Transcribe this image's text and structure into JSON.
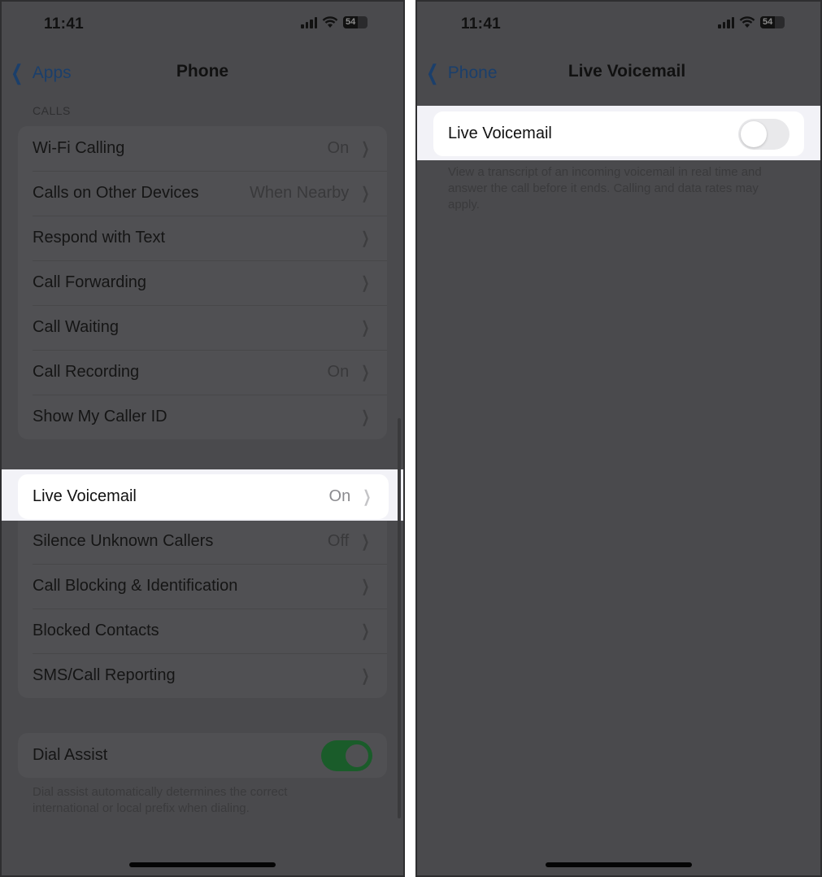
{
  "left": {
    "status": {
      "time": "11:41",
      "battery": "54"
    },
    "nav": {
      "back_label": "Apps",
      "title": "Phone"
    },
    "calls_section": {
      "header": "CALLS",
      "rows": [
        {
          "label": "Wi-Fi Calling",
          "value": "On"
        },
        {
          "label": "Calls on Other Devices",
          "value": "When Nearby"
        },
        {
          "label": "Respond with Text",
          "value": ""
        },
        {
          "label": "Call Forwarding",
          "value": ""
        },
        {
          "label": "Call Waiting",
          "value": ""
        },
        {
          "label": "Call Recording",
          "value": "On"
        },
        {
          "label": "Show My Caller ID",
          "value": ""
        }
      ]
    },
    "voicemail_section": {
      "highlighted_row": {
        "label": "Live Voicemail",
        "value": "On"
      },
      "rows": [
        {
          "label": "Silence Unknown Callers",
          "value": "Off"
        },
        {
          "label": "Call Blocking & Identification",
          "value": ""
        },
        {
          "label": "Blocked Contacts",
          "value": ""
        },
        {
          "label": "SMS/Call Reporting",
          "value": ""
        }
      ]
    },
    "dial_assist": {
      "label": "Dial Assist",
      "enabled": true,
      "footnote": "Dial assist automatically determines the correct international or local prefix when dialing."
    }
  },
  "right": {
    "status": {
      "time": "11:41",
      "battery": "54"
    },
    "nav": {
      "back_label": "Phone",
      "title": "Live Voicemail"
    },
    "toggle_row": {
      "label": "Live Voicemail",
      "enabled": false
    },
    "footnote": "View a transcript of an incoming voicemail in real time and answer the call before it ends. Calling and data rates may apply."
  },
  "icons": {
    "back": "chevron-left",
    "row_disclosure": "chevron-right",
    "signal": "cellular-signal",
    "wifi": "wifi",
    "battery": "battery"
  },
  "colors": {
    "ios_blue": "#007aff",
    "toggle_green": "#34c759",
    "overlay_bg": "#4a4a4d",
    "highlight_bg": "#f2f2f7"
  }
}
